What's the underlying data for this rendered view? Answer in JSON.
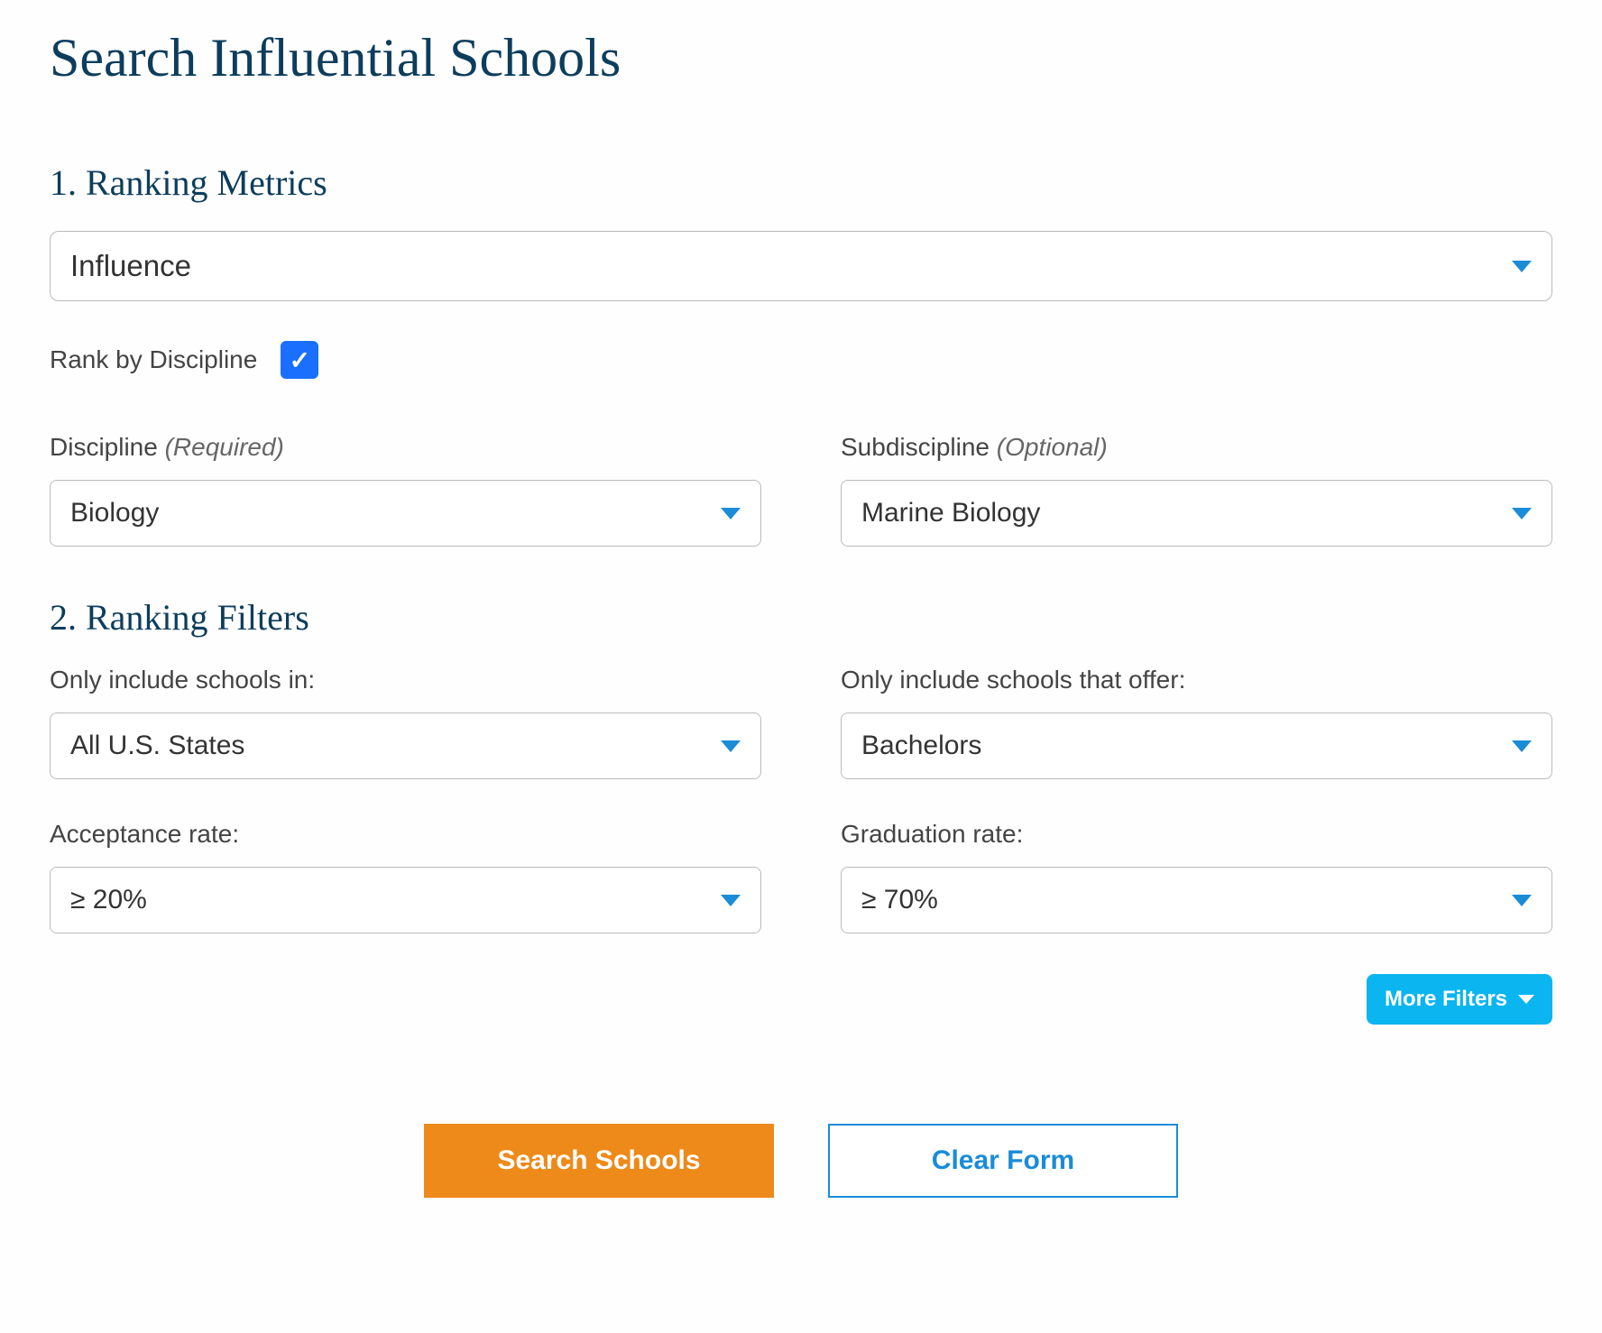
{
  "page_title": "Search Influential Schools",
  "section1": {
    "title": "1. Ranking Metrics",
    "ranking_metric_value": "Influence",
    "rank_by_discipline_label": "Rank by Discipline",
    "rank_by_discipline_checked": true,
    "discipline_label_text": "Discipline",
    "discipline_label_hint": "(Required)",
    "discipline_value": "Biology",
    "subdiscipline_label_text": "Subdiscipline",
    "subdiscipline_label_hint": "(Optional)",
    "subdiscipline_value": "Marine Biology"
  },
  "section2": {
    "title": "2. Ranking Filters",
    "location_label": "Only include schools in:",
    "location_value": "All U.S. States",
    "degree_label": "Only include schools that offer:",
    "degree_value": "Bachelors",
    "acceptance_label": "Acceptance rate:",
    "acceptance_value": "≥ 20%",
    "graduation_label": "Graduation rate:",
    "graduation_value": "≥ 70%",
    "more_filters_label": "More Filters"
  },
  "buttons": {
    "search": "Search Schools",
    "clear": "Clear Form"
  }
}
